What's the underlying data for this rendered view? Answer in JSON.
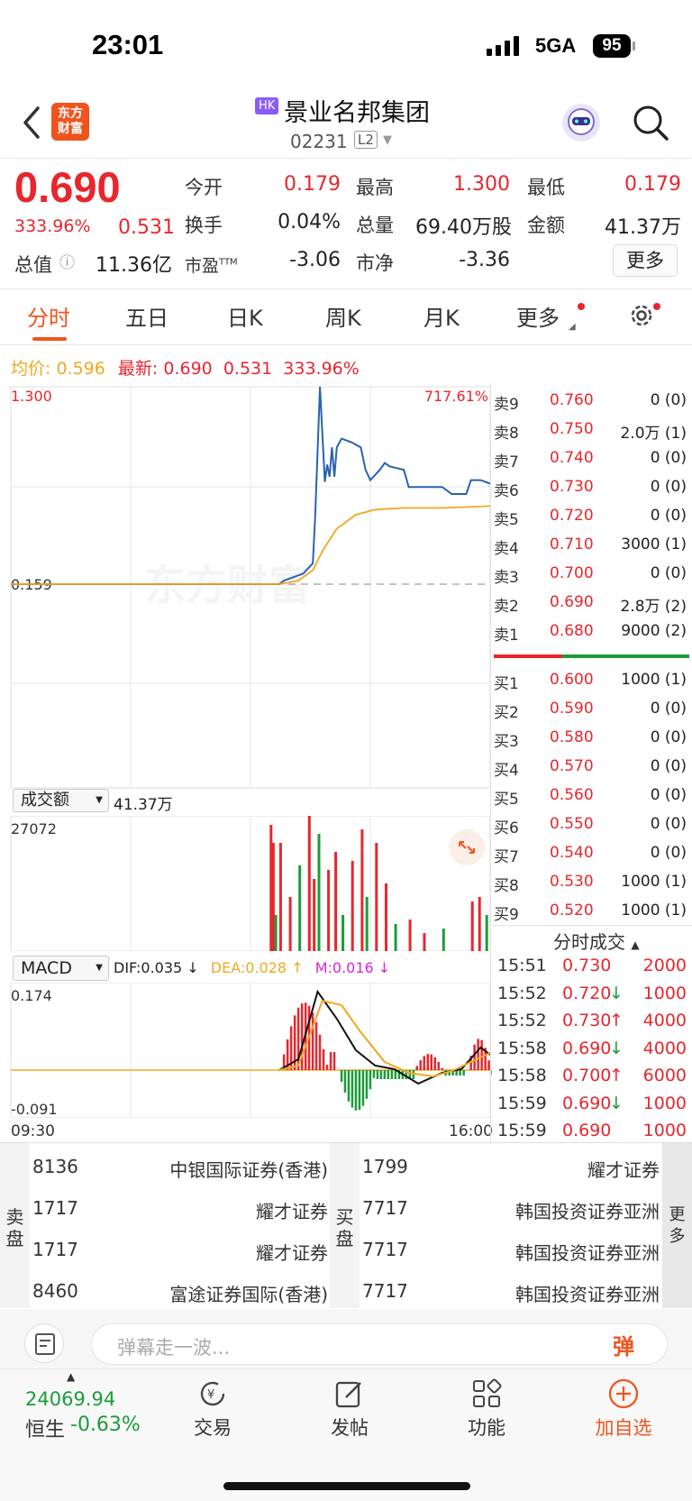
{
  "status_bar": {
    "time": "23:01",
    "network": "5GA",
    "battery": "95"
  },
  "header": {
    "logo_text": "东方\n财富",
    "market_tag": "HK",
    "stock_name": "景业名邦集团",
    "stock_code": "02231",
    "level_tag": "L2"
  },
  "quote": {
    "price": "0.690",
    "change_pct": "333.96%",
    "change": "0.531",
    "market_cap_label": "总值",
    "market_cap": "11.36亿",
    "open_label": "今开",
    "open": "0.179",
    "high_label": "最高",
    "high": "1.300",
    "low_label": "最低",
    "low": "0.179",
    "turnover_label": "换手",
    "turnover": "0.04%",
    "volume_label": "总量",
    "volume": "69.40万股",
    "amount_label": "金额",
    "amount": "41.37万",
    "pe_label": "市盈",
    "pe_sup": "TTM",
    "pe": "-3.06",
    "pb_label": "市净",
    "pb": "-3.36",
    "more_label": "更多"
  },
  "tabs": [
    "分时",
    "五日",
    "日K",
    "周K",
    "月K",
    "更多"
  ],
  "info_line": {
    "avg_label": "均价:",
    "avg": "0.596",
    "latest_label": "最新:",
    "latest": "0.690",
    "change": "0.531",
    "change_pct": "333.96%"
  },
  "chart_data": [
    {
      "type": "line",
      "title": "分时",
      "y_max_label": "1.300",
      "y_ref_label": "0.159",
      "right_top_label": "717.61%",
      "watermark": "东方财富",
      "x_labels": [
        "09:30",
        "16:00"
      ],
      "series": [
        {
          "color": "#2a62b0",
          "points": [
            [
              0,
              0.159
            ],
            [
              0.56,
              0.159
            ],
            [
              0.57,
              0.18
            ],
            [
              0.61,
              0.22
            ],
            [
              0.63,
              0.28
            ],
            [
              0.635,
              0.55
            ],
            [
              0.645,
              1.3
            ],
            [
              0.655,
              0.75
            ],
            [
              0.66,
              0.85
            ],
            [
              0.665,
              0.78
            ],
            [
              0.67,
              0.95
            ],
            [
              0.675,
              0.78
            ],
            [
              0.68,
              0.95
            ],
            [
              0.69,
              1.0
            ],
            [
              0.71,
              0.98
            ],
            [
              0.73,
              0.95
            ],
            [
              0.74,
              0.82
            ],
            [
              0.75,
              0.76
            ],
            [
              0.77,
              0.82
            ],
            [
              0.78,
              0.86
            ],
            [
              0.79,
              0.84
            ],
            [
              0.82,
              0.82
            ],
            [
              0.83,
              0.72
            ],
            [
              0.9,
              0.72
            ],
            [
              0.92,
              0.68
            ],
            [
              0.95,
              0.68
            ],
            [
              0.96,
              0.76
            ],
            [
              0.98,
              0.76
            ],
            [
              1.0,
              0.74
            ]
          ]
        },
        {
          "color": "#f0a820",
          "points": [
            [
              0,
              0.159
            ],
            [
              0.56,
              0.159
            ],
            [
              0.6,
              0.18
            ],
            [
              0.63,
              0.24
            ],
            [
              0.65,
              0.35
            ],
            [
              0.68,
              0.48
            ],
            [
              0.72,
              0.56
            ],
            [
              0.76,
              0.59
            ],
            [
              0.82,
              0.6
            ],
            [
              0.9,
              0.6
            ],
            [
              1.0,
              0.61
            ]
          ]
        }
      ]
    },
    {
      "type": "bar",
      "title": "成交额",
      "selector_label": "成交额",
      "total": "41.37万",
      "y_max_label": "27072"
    },
    {
      "type": "macd",
      "selector_label": "MACD",
      "dif": "DIF:0.035",
      "dea": "DEA:0.028",
      "m": "M:0.016",
      "y_max_label": "0.174",
      "y_min_label": "-0.091"
    }
  ],
  "order_book": {
    "asks": [
      {
        "label": "卖9",
        "price": "0.760",
        "vol": "0 (0)"
      },
      {
        "label": "卖8",
        "price": "0.750",
        "vol": "2.0万 (1)"
      },
      {
        "label": "卖7",
        "price": "0.740",
        "vol": "0 (0)"
      },
      {
        "label": "卖6",
        "price": "0.730",
        "vol": "0 (0)"
      },
      {
        "label": "卖5",
        "price": "0.720",
        "vol": "0 (0)"
      },
      {
        "label": "卖4",
        "price": "0.710",
        "vol": "3000 (1)"
      },
      {
        "label": "卖3",
        "price": "0.700",
        "vol": "0 (0)"
      },
      {
        "label": "卖2",
        "price": "0.690",
        "vol": "2.8万 (2)"
      },
      {
        "label": "卖1",
        "price": "0.680",
        "vol": "9000 (2)"
      }
    ],
    "bids": [
      {
        "label": "买1",
        "price": "0.600",
        "vol": "1000 (1)"
      },
      {
        "label": "买2",
        "price": "0.590",
        "vol": "0 (0)"
      },
      {
        "label": "买3",
        "price": "0.580",
        "vol": "0 (0)"
      },
      {
        "label": "买4",
        "price": "0.570",
        "vol": "0 (0)"
      },
      {
        "label": "买5",
        "price": "0.560",
        "vol": "0 (0)"
      },
      {
        "label": "买6",
        "price": "0.550",
        "vol": "0 (0)"
      },
      {
        "label": "买7",
        "price": "0.540",
        "vol": "0 (0)"
      },
      {
        "label": "买8",
        "price": "0.530",
        "vol": "1000 (1)"
      },
      {
        "label": "买9",
        "price": "0.520",
        "vol": "1000 (1)"
      }
    ]
  },
  "ticks": {
    "title": "分时成交",
    "rows": [
      {
        "time": "15:51",
        "price": "0.730",
        "arrow": "",
        "vol": "2000"
      },
      {
        "time": "15:52",
        "price": "0.720",
        "arrow": "↓",
        "vol": "1000"
      },
      {
        "time": "15:52",
        "price": "0.730",
        "arrow": "↑",
        "vol": "4000"
      },
      {
        "time": "15:58",
        "price": "0.690",
        "arrow": "↓",
        "vol": "4000"
      },
      {
        "time": "15:58",
        "price": "0.700",
        "arrow": "↑",
        "vol": "6000"
      },
      {
        "time": "15:59",
        "price": "0.690",
        "arrow": "↓",
        "vol": "1000"
      },
      {
        "time": "15:59",
        "price": "0.690",
        "arrow": "",
        "vol": "1000"
      }
    ]
  },
  "brokers": {
    "sell_label": "卖\n盘",
    "buy_label": "买\n盘",
    "more_label": "更\n多",
    "sell": [
      {
        "code": "8136",
        "name": "中银国际证券(香港)"
      },
      {
        "code": "1717",
        "name": "耀才证券"
      },
      {
        "code": "1717",
        "name": "耀才证券"
      },
      {
        "code": "8460",
        "name": "富途证券国际(香港)"
      }
    ],
    "buy": [
      {
        "code": "1799",
        "name": "耀才证券"
      },
      {
        "code": "7717",
        "name": "韩国投资证券亚洲"
      },
      {
        "code": "7717",
        "name": "韩国投资证券亚洲"
      },
      {
        "code": "7717",
        "name": "韩国投资证券亚洲"
      }
    ]
  },
  "comment": {
    "placeholder": "弹幕走一波...",
    "danmu_btn": "弹"
  },
  "bottom_nav": {
    "index_value": "24069.94",
    "index_name": "恒生",
    "index_pct": "-0.63%",
    "items": [
      "交易",
      "发帖",
      "功能",
      "加自选"
    ]
  },
  "colors": {
    "up": "#e8262d",
    "down": "#1b9c3a",
    "accent": "#f0541e",
    "price_line": "#2a62b0",
    "avg_line": "#f0a820"
  }
}
